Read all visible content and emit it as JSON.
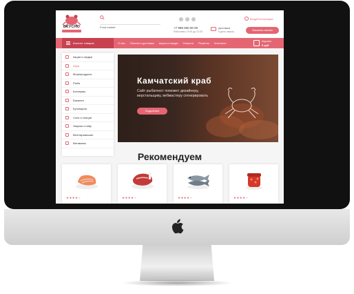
{
  "header": {
    "logo_text": "ВКУСНО",
    "search_value": "Food market",
    "phone_number": "+7 999 000 00 00",
    "phone_note": "Работаем с 9:00 до 21:00",
    "delivery_title": "Доставка",
    "delivery_note": "в день заказа",
    "account_label": "Вход/Регистрация",
    "callback_button": "Заказать звонок",
    "socials": [
      "vk-icon",
      "facebook-icon",
      "instagram-icon"
    ]
  },
  "nav": {
    "catalog_label": "Каталог товаров",
    "links": [
      "О нас",
      "Оплата и доставка",
      "Акции и скидки",
      "Новости",
      "Рецепты",
      "Контакты"
    ],
    "cart_label": "Корзина",
    "cart_total": "0 руб"
  },
  "sidebar": {
    "items": [
      {
        "label": "Акции и скидки",
        "active": false
      },
      {
        "label": "Икра",
        "active": true
      },
      {
        "label": "Морепродукты",
        "active": false
      },
      {
        "label": "Рыба",
        "active": false
      },
      {
        "label": "Консервы",
        "active": false
      },
      {
        "label": "Бакалея",
        "active": false
      },
      {
        "label": "Кулинария",
        "active": false
      },
      {
        "label": "Соль и специи",
        "active": false
      },
      {
        "label": "Закуски к пиву",
        "active": false
      },
      {
        "label": "Вегетарианские",
        "active": false
      },
      {
        "label": "Витамины",
        "active": false
      }
    ]
  },
  "hero": {
    "title": "Камчатский краб",
    "subtitle": "Сайт рыбатекст поможет дизайнеру, верстальщику, вебмастеру сгенерировать",
    "button": "Подробнее"
  },
  "recommend": {
    "title": "Рекомендуем",
    "products": [
      {
        "image": "salmon-steak",
        "rating": 4
      },
      {
        "image": "meat-steak",
        "rating": 4
      },
      {
        "image": "fish",
        "rating": 4
      },
      {
        "image": "red-caviar-jar",
        "rating": 4
      }
    ]
  },
  "colors": {
    "accent": "#e46673",
    "accent_dark": "#c8414f",
    "bezel": "#111111"
  }
}
